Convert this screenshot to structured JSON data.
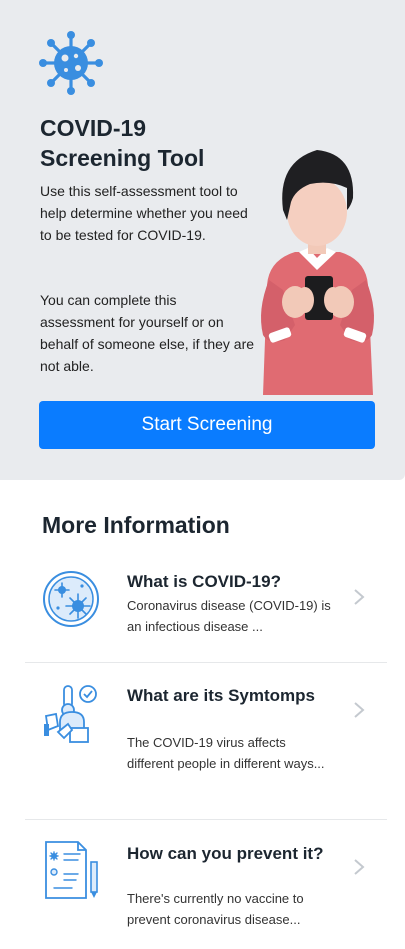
{
  "hero": {
    "logo_icon": "virus-icon",
    "title": "COVID-19 Screening Tool",
    "description_1": "Use this self-assessment tool to help determine whether you need to be tested for COVID-19.",
    "description_2": "You can complete this assessment for yourself or on behalf of someone else, if they are not able.",
    "illustration": "person-with-phone-illustration",
    "start_button_label": "Start Screening"
  },
  "more_info": {
    "heading": "More Information",
    "items": [
      {
        "icon": "virus-circle-icon",
        "title": "What is COVID-19?",
        "description": "Coronavirus disease (COVID-19) is an infectious disease ..."
      },
      {
        "icon": "symptoms-icon",
        "title": "What are its Symtomps",
        "description": "The COVID-19 virus affects different people in different ways..."
      },
      {
        "icon": "prevention-document-icon",
        "title": "How can you prevent it?",
        "description": "There's currently no vaccine to prevent coronavirus disease..."
      }
    ]
  },
  "colors": {
    "hero_background": "#e9ebee",
    "primary": "#0a7cff",
    "icon_blue": "#3a8ee0",
    "sweater": "#e06b72"
  }
}
